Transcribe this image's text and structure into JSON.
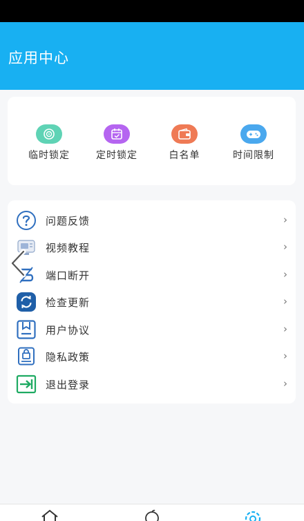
{
  "header": {
    "title": "应用中心"
  },
  "quick_actions": [
    {
      "label": "临时锁定",
      "icon": "temporary-lock-icon",
      "color": "#5fd3b5"
    },
    {
      "label": "定时锁定",
      "icon": "scheduled-lock-calendar-icon",
      "color": "#b565f0"
    },
    {
      "label": "白名单",
      "icon": "whitelist-wallet-icon",
      "color": "#ef7a55"
    },
    {
      "label": "时间限制",
      "icon": "time-limit-gamepad-icon",
      "color": "#4aa8ee"
    }
  ],
  "menu": [
    {
      "label": "问题反馈",
      "icon": "question-icon"
    },
    {
      "label": "视频教程",
      "icon": "video-tutorial-icon"
    },
    {
      "label": "端口断开",
      "icon": "port-disconnect-icon"
    },
    {
      "label": "检查更新",
      "icon": "refresh-update-icon"
    },
    {
      "label": "用户协议",
      "icon": "user-agreement-icon"
    },
    {
      "label": "隐私政策",
      "icon": "privacy-policy-lock-icon"
    },
    {
      "label": "退出登录",
      "icon": "logout-icon"
    }
  ],
  "chevron": "›",
  "colors": {
    "header": "#18b0f2",
    "active_tab": "#18b0f2",
    "update_icon": "#1f5fa8",
    "logout_icon": "#1eaa62"
  },
  "tabs": [
    {
      "icon": "home-icon"
    },
    {
      "icon": "apps-icon"
    },
    {
      "icon": "settings-icon",
      "active": true
    }
  ]
}
